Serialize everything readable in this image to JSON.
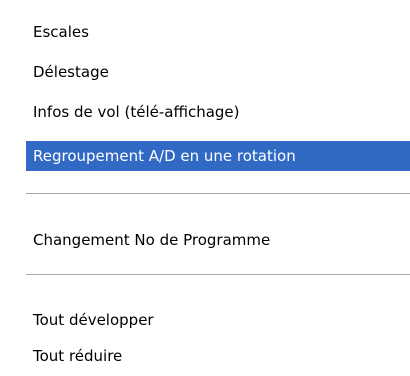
{
  "menu": {
    "items": [
      {
        "label": "Escales"
      },
      {
        "label": "Délestage"
      },
      {
        "label": "Infos de vol (télé-affichage)"
      },
      {
        "label": "Regroupement A/D en une rotation",
        "state": "highlighted"
      },
      {
        "label": "Changement No de Programme"
      },
      {
        "label": "Tout développer"
      },
      {
        "label": "Tout réduire"
      }
    ]
  },
  "colors": {
    "highlight_background": "#316ac5",
    "highlight_text": "#ffffff",
    "menu_background": "#ffffff",
    "separator": "#aca899"
  }
}
